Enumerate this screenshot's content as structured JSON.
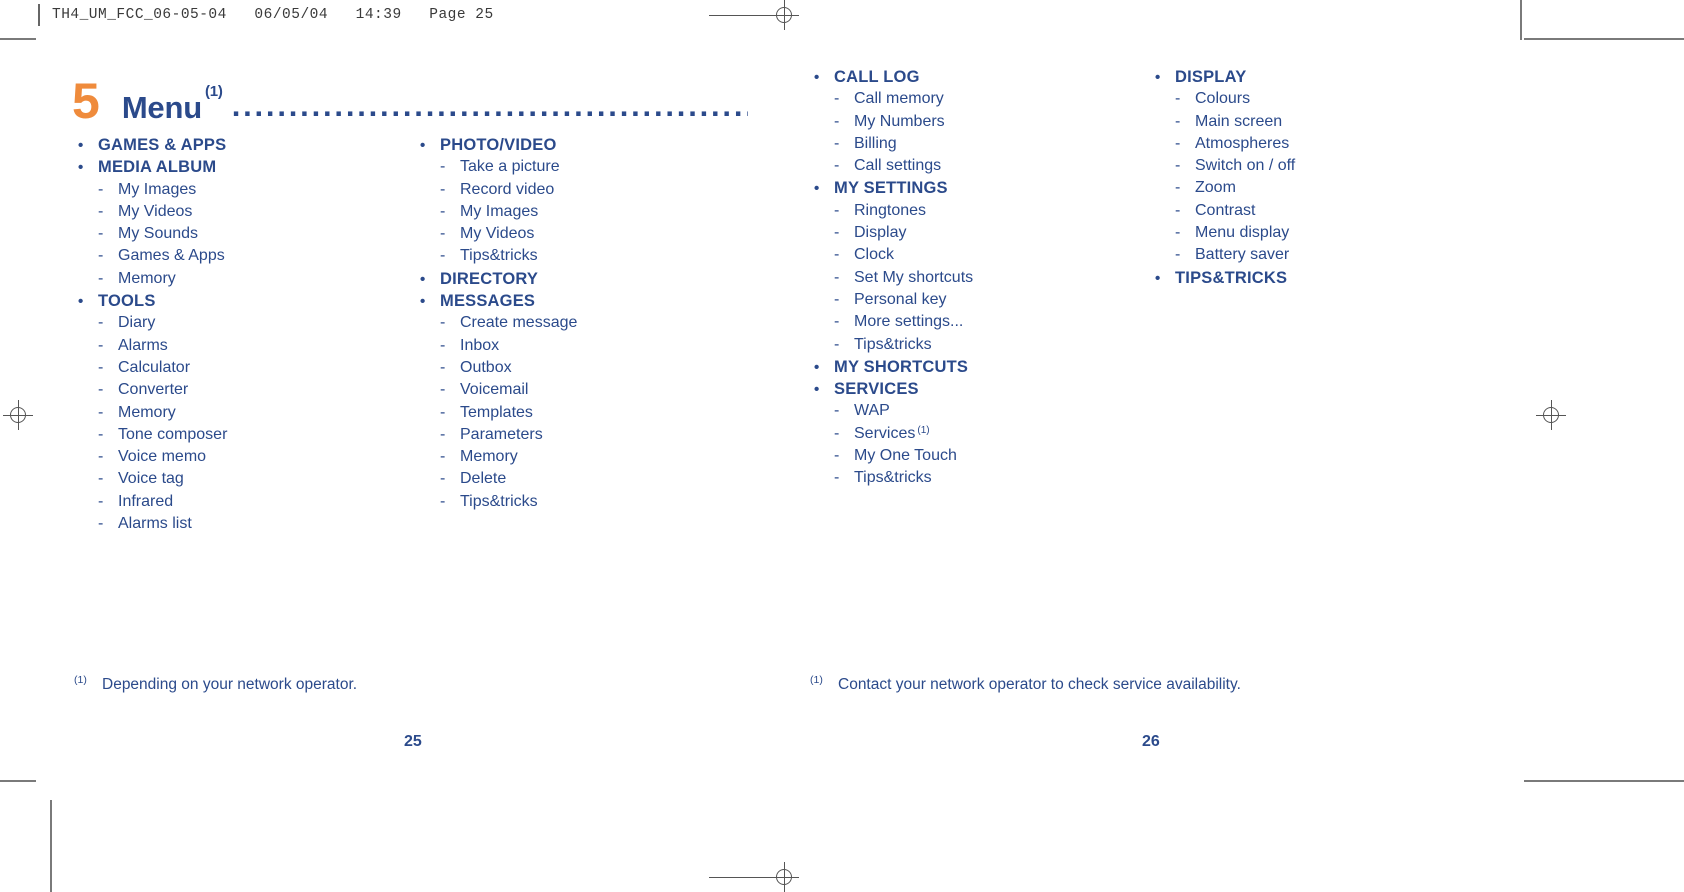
{
  "prepress": {
    "header": "TH4_UM_FCC_06-05-04   06/05/04   14:39   Page 25"
  },
  "chapter": {
    "number": "5",
    "title": "Menu",
    "superscript": "(1)",
    "dots": "........................................................."
  },
  "colors": {
    "accent_orange": "#ef8b3c",
    "text_blue": "#2b4a8b"
  },
  "columns": [
    {
      "id": "column-1",
      "groups": [
        {
          "title": "GAMES & APPS",
          "items": []
        },
        {
          "title": "MEDIA ALBUM",
          "items": [
            "My Images",
            "My Videos",
            "My Sounds",
            "Games & Apps",
            "Memory"
          ]
        },
        {
          "title": "TOOLS",
          "items": [
            "Diary",
            "Alarms",
            "Calculator",
            "Converter",
            "Memory",
            "Tone composer",
            "Voice memo",
            "Voice tag",
            "Infrared",
            "Alarms list"
          ]
        }
      ]
    },
    {
      "id": "column-2",
      "groups": [
        {
          "title": "PHOTO/VIDEO",
          "items": [
            "Take a picture",
            "Record video",
            "My Images",
            "My Videos",
            "Tips&tricks"
          ]
        },
        {
          "title": "DIRECTORY",
          "items": []
        },
        {
          "title": "MESSAGES",
          "items": [
            "Create message",
            "Inbox",
            "Outbox",
            "Voicemail",
            "Templates",
            "Parameters",
            "Memory",
            "Delete",
            "Tips&tricks"
          ]
        }
      ]
    },
    {
      "id": "column-3",
      "groups": [
        {
          "title": "CALL LOG",
          "items": [
            "Call memory",
            "My Numbers",
            "Billing",
            "Call settings"
          ]
        },
        {
          "title": "MY SETTINGS",
          "items": [
            "Ringtones",
            "Display",
            "Clock",
            "Set My shortcuts",
            "Personal key",
            "More settings...",
            "Tips&tricks"
          ]
        },
        {
          "title": "MY SHORTCUTS",
          "items": []
        },
        {
          "title": "SERVICES",
          "items": [
            "WAP",
            "Services",
            "My One Touch",
            "Tips&tricks"
          ],
          "item_superscripts": {
            "1": "(1)"
          }
        }
      ]
    },
    {
      "id": "column-4",
      "groups": [
        {
          "title": "DISPLAY",
          "items": [
            "Colours",
            "Main screen",
            "Atmospheres",
            "Switch on / off",
            "Zoom",
            "Contrast",
            "Menu display",
            "Battery saver"
          ]
        },
        {
          "title": "TIPS&TRICKS",
          "items": []
        }
      ]
    }
  ],
  "footnotes": {
    "left": {
      "mark": "(1)",
      "text": "Depending on your network operator."
    },
    "right": {
      "mark": "(1)",
      "text": "Contact your network operator to check service availability."
    }
  },
  "page_numbers": {
    "left": "25",
    "right": "26"
  }
}
